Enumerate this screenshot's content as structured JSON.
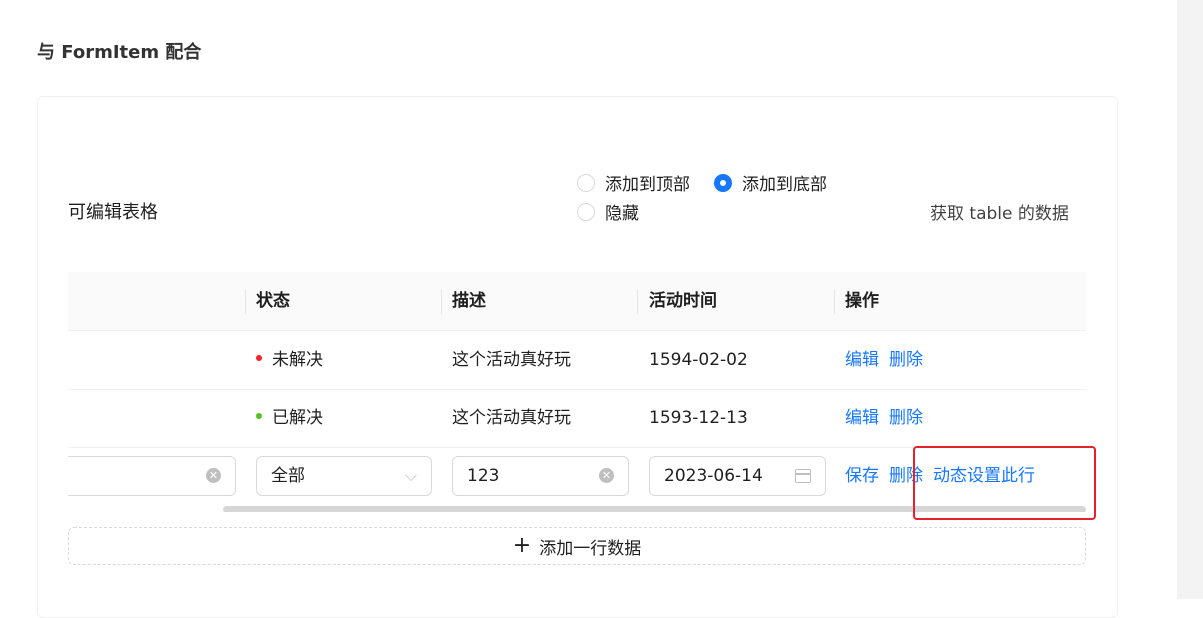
{
  "section": {
    "title": "与 FormItem 配合"
  },
  "toolbar": {
    "title": "可编辑表格",
    "radios": [
      {
        "label": "添加到顶部",
        "checked": false
      },
      {
        "label": "添加到底部",
        "checked": true
      },
      {
        "label": "隐藏",
        "checked": false
      }
    ],
    "fetch_label": "获取 table 的数据"
  },
  "table": {
    "columns": [
      "状态",
      "描述",
      "活动时间",
      "操作"
    ],
    "rows": [
      {
        "status": "未解决",
        "status_color": "#f5222d",
        "desc": "这个活动真好玩",
        "date": "1594-02-02",
        "actions": [
          "编辑",
          "删除"
        ]
      },
      {
        "status": "已解决",
        "status_color": "#52c41a",
        "desc": "这个活动真好玩",
        "date": "1593-12-13",
        "actions": [
          "编辑",
          "删除"
        ]
      }
    ],
    "edit_row": {
      "status_value": "全部",
      "desc_value": "123",
      "date_value": "2023-06-14",
      "actions": [
        "保存",
        "删除",
        "动态设置此行"
      ]
    }
  },
  "add_row_label": "添加一行数据",
  "colors": {
    "primary": "#1677ff",
    "highlight": "#e8202a"
  }
}
